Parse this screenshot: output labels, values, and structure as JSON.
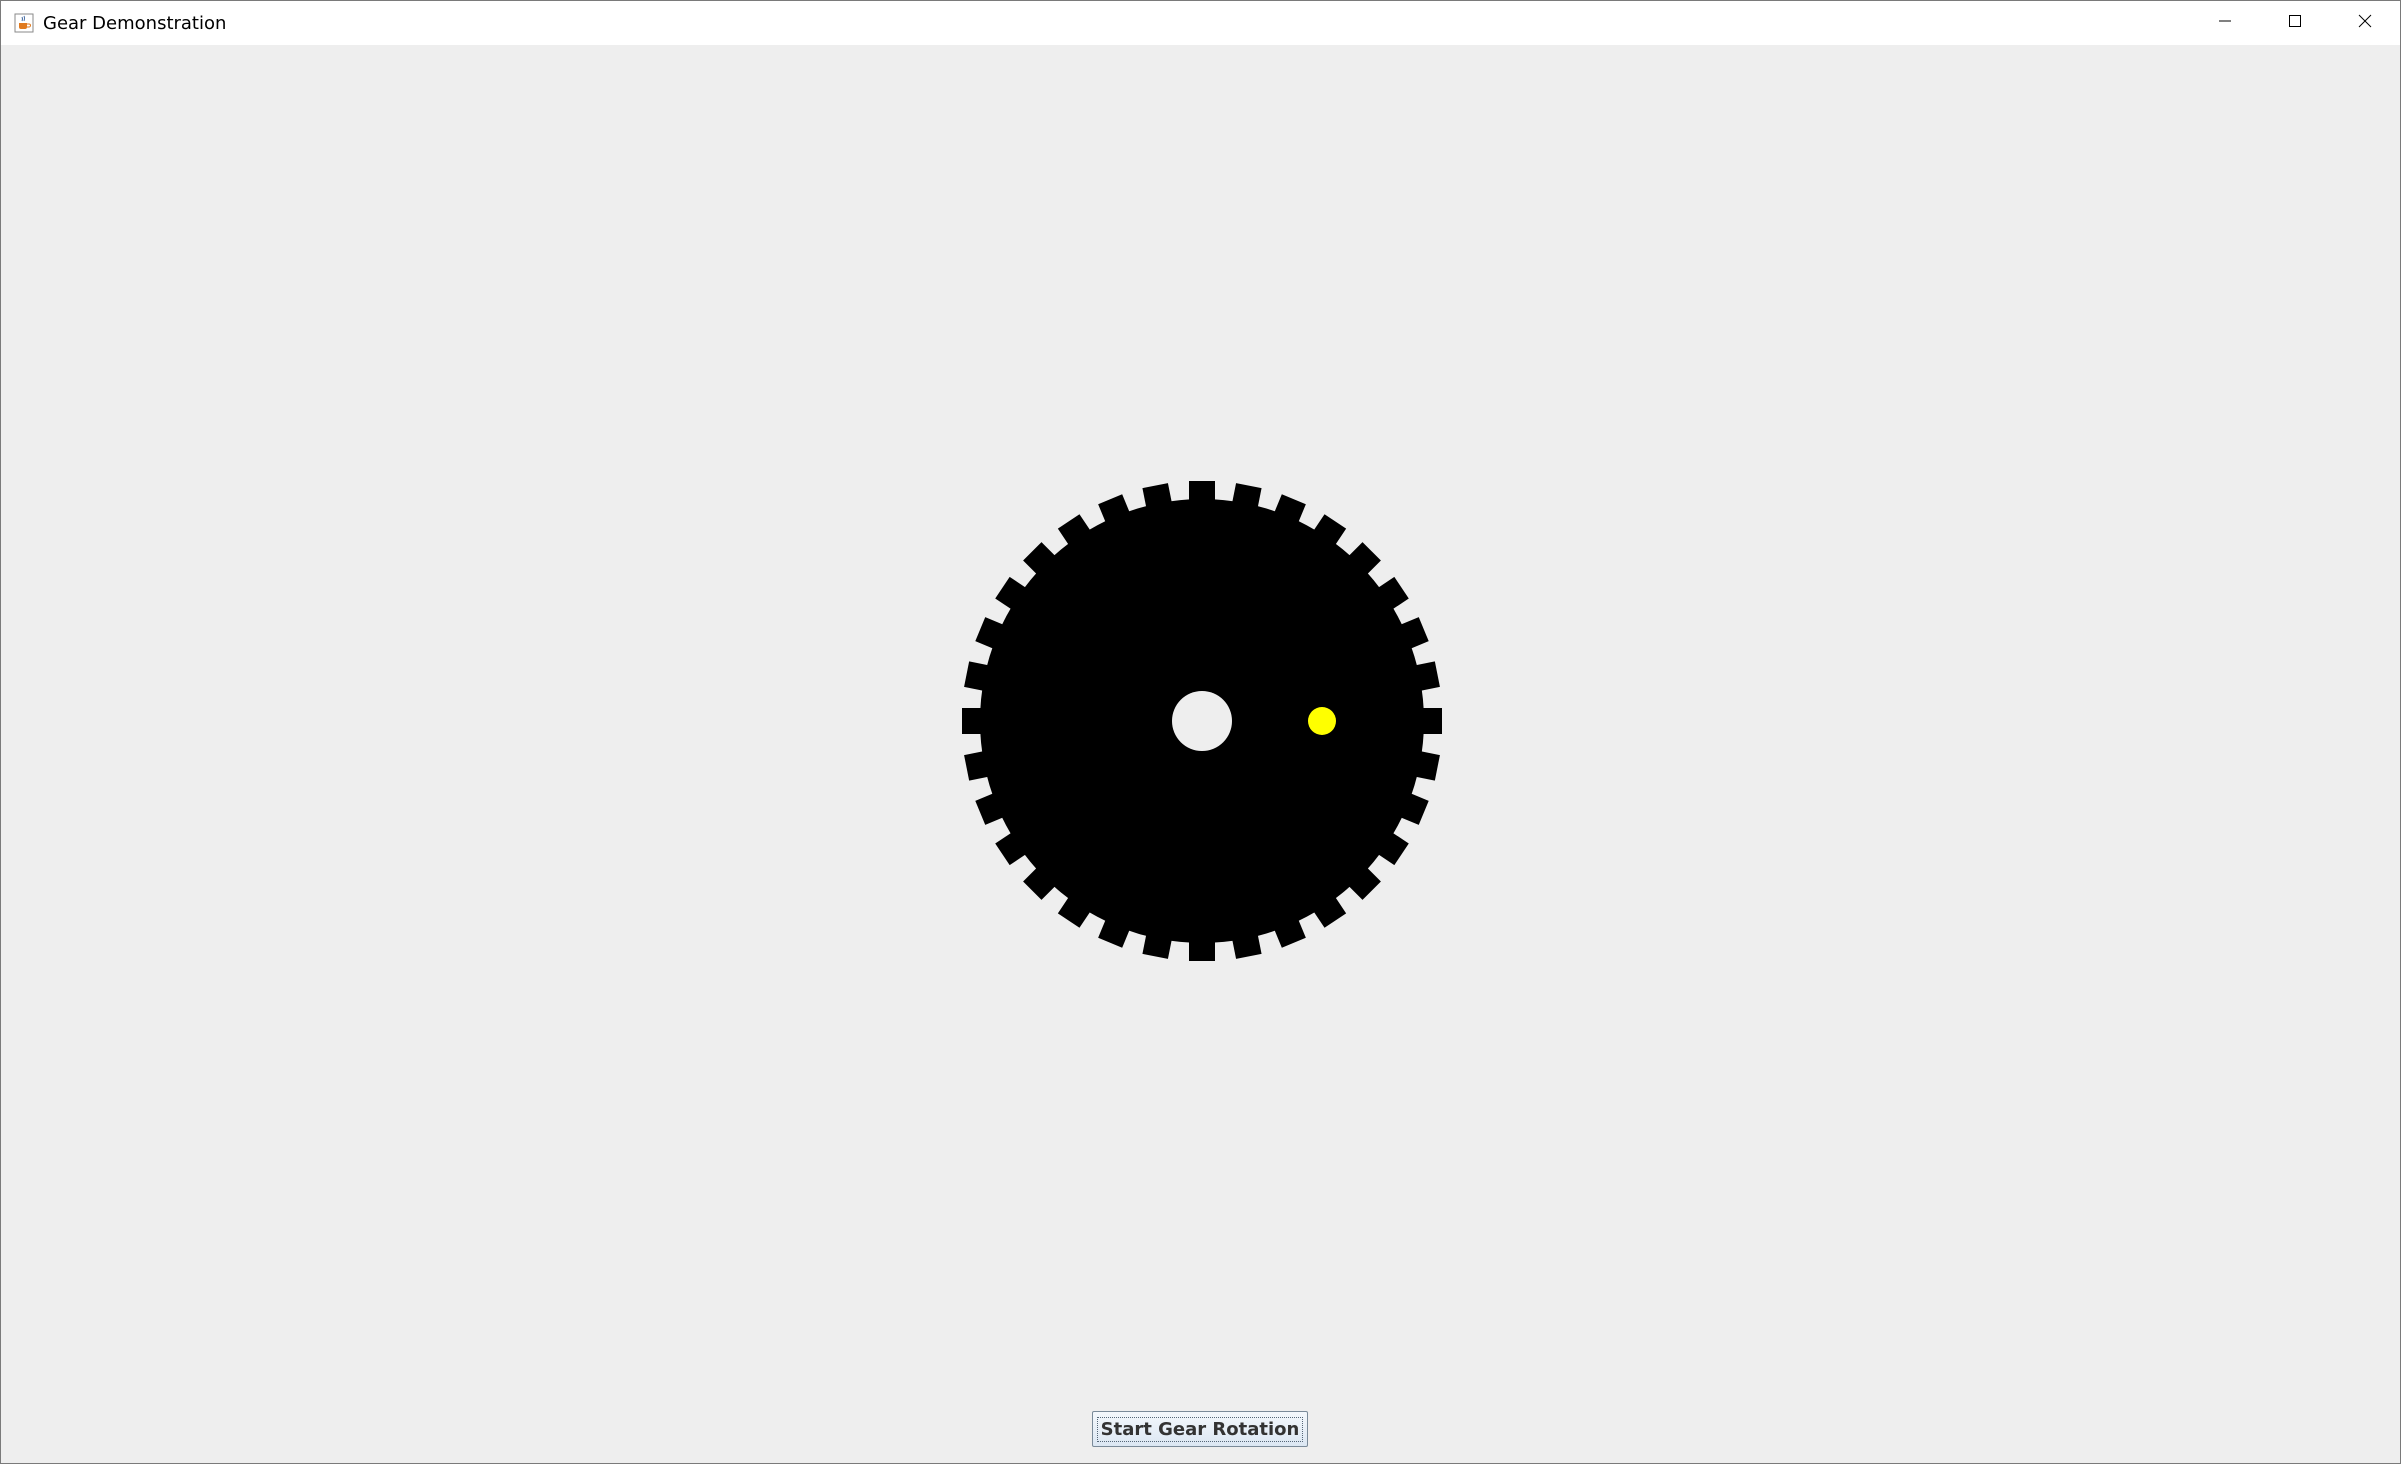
{
  "window": {
    "title": "Gear Demonstration",
    "app_icon": "java-cup-icon",
    "controls": {
      "minimize_icon": "minimize-icon",
      "maximize_icon": "maximize-icon",
      "close_icon": "close-icon"
    }
  },
  "gear": {
    "tooth_count": 32,
    "body_color": "#000000",
    "hub_hole_color": "#eeeeee",
    "marker_color": "#ffff00"
  },
  "controls": {
    "start_button_label": "Start Gear Rotation"
  }
}
